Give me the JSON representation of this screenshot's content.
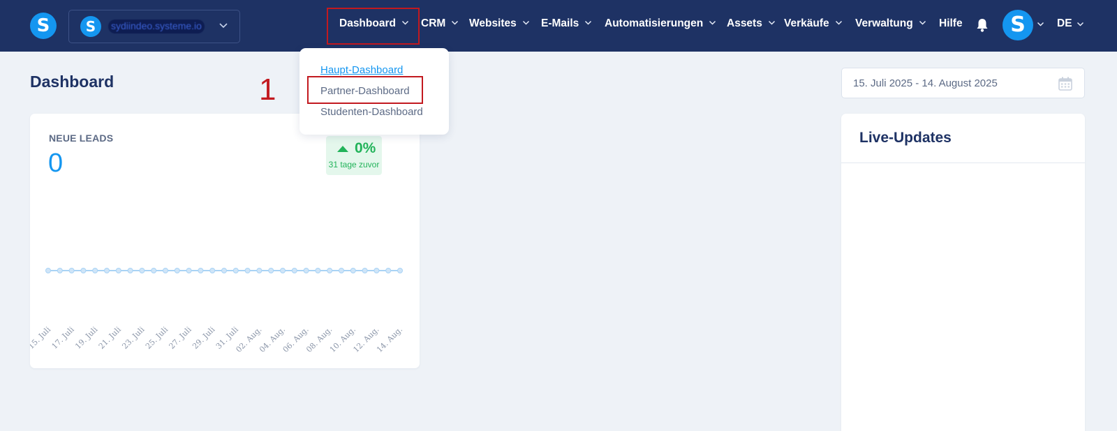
{
  "header": {
    "site_name": "sydiindeo.systeme.io",
    "nav": [
      {
        "label": "Dashboard"
      },
      {
        "label": "CRM"
      },
      {
        "label": "Websites"
      },
      {
        "label": "E-Mails"
      },
      {
        "label": "Automatisierungen"
      },
      {
        "label": "Assets"
      },
      {
        "label": "Verkäufe"
      },
      {
        "label": "Verwaltung"
      },
      {
        "label": "Hilfe"
      }
    ],
    "language": "DE",
    "logo_letter": "S",
    "avatar_letter": "S"
  },
  "page": {
    "title": "Dashboard",
    "step_marker": "1"
  },
  "dashboard_menu": {
    "items": [
      {
        "label": "Haupt-Dashboard",
        "active": true
      },
      {
        "label": "Partner-Dashboard",
        "active": false
      },
      {
        "label": "Studenten-Dashboard",
        "active": false
      }
    ]
  },
  "date_range": {
    "value": "15. Juli 2025 - 14. August 2025"
  },
  "leads_card": {
    "label": "NEUE LEADS",
    "value": "0",
    "trend_value": "0%",
    "trend_period": "31 tage zuvor"
  },
  "live_updates": {
    "title": "Live-Updates"
  },
  "chart_data": {
    "type": "line",
    "x": [
      "15. Juli",
      "16. Juli",
      "17. Juli",
      "18. Juli",
      "19. Juli",
      "20. Juli",
      "21. Juli",
      "22. Juli",
      "23. Juli",
      "24. Juli",
      "25. Juli",
      "26. Juli",
      "27. Juli",
      "28. Juli",
      "29. Juli",
      "30. Juli",
      "31. Juli",
      "01. Aug.",
      "02. Aug.",
      "03. Aug.",
      "04. Aug.",
      "05. Aug.",
      "06. Aug.",
      "07. Aug.",
      "08. Aug.",
      "09. Aug.",
      "10. Aug.",
      "11. Aug.",
      "12. Aug.",
      "13. Aug.",
      "14. Aug."
    ],
    "tick_labels": [
      "15. Juli",
      "17. Juli",
      "19. Juli",
      "21. Juli",
      "23. Juli",
      "25. Juli",
      "27. Juli",
      "29. Juli",
      "31. Juli",
      "02. Aug.",
      "04. Aug.",
      "06. Aug.",
      "08. Aug.",
      "10. Aug.",
      "12. Aug.",
      "14. Aug."
    ],
    "series": [
      {
        "values": [
          0,
          0,
          0,
          0,
          0,
          0,
          0,
          0,
          0,
          0,
          0,
          0,
          0,
          0,
          0,
          0,
          0,
          0,
          0,
          0,
          0,
          0,
          0,
          0,
          0,
          0,
          0,
          0,
          0,
          0,
          0
        ]
      }
    ],
    "color": "#a9d3f5",
    "grid": false
  },
  "colors": {
    "nav_bg": "#1e3264",
    "accent": "#1496f0",
    "highlight": "#c2191f",
    "positive": "#22b35a"
  },
  "icons": {
    "bell": "bell-icon",
    "calendar": "calendar-icon",
    "chevron": "chevron-down-icon"
  }
}
